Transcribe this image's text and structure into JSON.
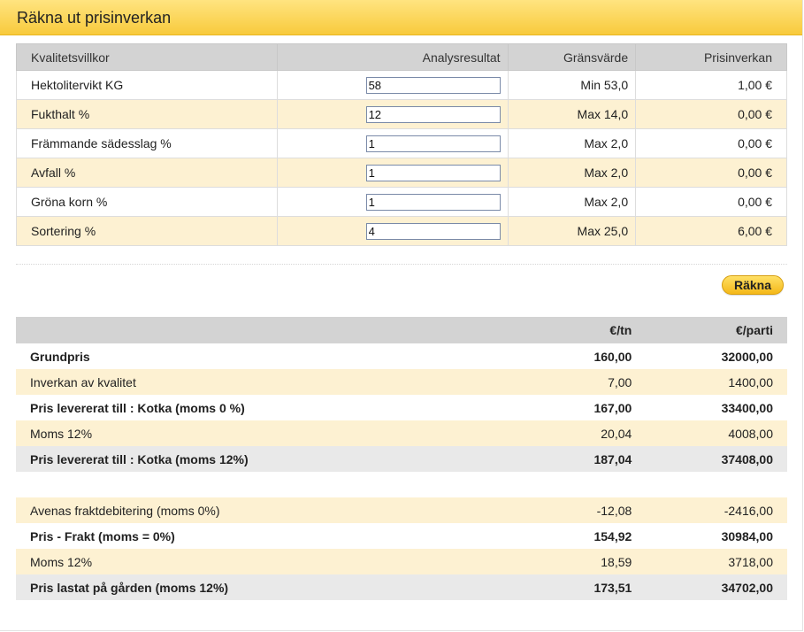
{
  "header": {
    "title": "Räkna ut prisinverkan"
  },
  "quality": {
    "columns": [
      "Kvalitetsvillkor",
      "Analysresultat",
      "Gränsvärde",
      "Prisinverkan"
    ],
    "rows": [
      {
        "label": "Hektolitervikt KG",
        "value": "58",
        "limit": "Min 53,0",
        "impact": "1,00 €"
      },
      {
        "label": "Fukthalt %",
        "value": "12",
        "limit": "Max 14,0",
        "impact": "0,00 €"
      },
      {
        "label": "Främmande sädesslag %",
        "value": "1",
        "limit": "Max 2,0",
        "impact": "0,00 €"
      },
      {
        "label": "Avfall %",
        "value": "1",
        "limit": "Max 2,0",
        "impact": "0,00 €"
      },
      {
        "label": "Gröna korn %",
        "value": "1",
        "limit": "Max 2,0",
        "impact": "0,00 €"
      },
      {
        "label": "Sortering %",
        "value": "4",
        "limit": "Max 25,0",
        "impact": "6,00 €"
      }
    ]
  },
  "calculate_button": {
    "label": "Räkna"
  },
  "price": {
    "columns": [
      "",
      "€/tn",
      "€/parti"
    ],
    "rows": [
      {
        "label": "Grundpris",
        "per_ton": "160,00",
        "per_lot": "32000,00"
      },
      {
        "label": "Inverkan av kvalitet",
        "per_ton": "7,00",
        "per_lot": "1400,00"
      },
      {
        "label": "Pris levererat till : Kotka (moms 0 %)",
        "per_ton": "167,00",
        "per_lot": "33400,00"
      },
      {
        "label": "Moms 12%",
        "per_ton": "20,04",
        "per_lot": "4008,00"
      },
      {
        "label": "Pris levererat till : Kotka (moms 12%)",
        "per_ton": "187,04",
        "per_lot": "37408,00"
      },
      {
        "label": "Avenas fraktdebitering (moms 0%)",
        "per_ton": "-12,08",
        "per_lot": "-2416,00"
      },
      {
        "label": "Pris - Frakt (moms = 0%)",
        "per_ton": "154,92",
        "per_lot": "30984,00"
      },
      {
        "label": "Moms 12%",
        "per_ton": "18,59",
        "per_lot": "3718,00"
      },
      {
        "label": "Pris lastat på gården (moms 12%)",
        "per_ton": "173,51",
        "per_lot": "34702,00"
      }
    ]
  }
}
